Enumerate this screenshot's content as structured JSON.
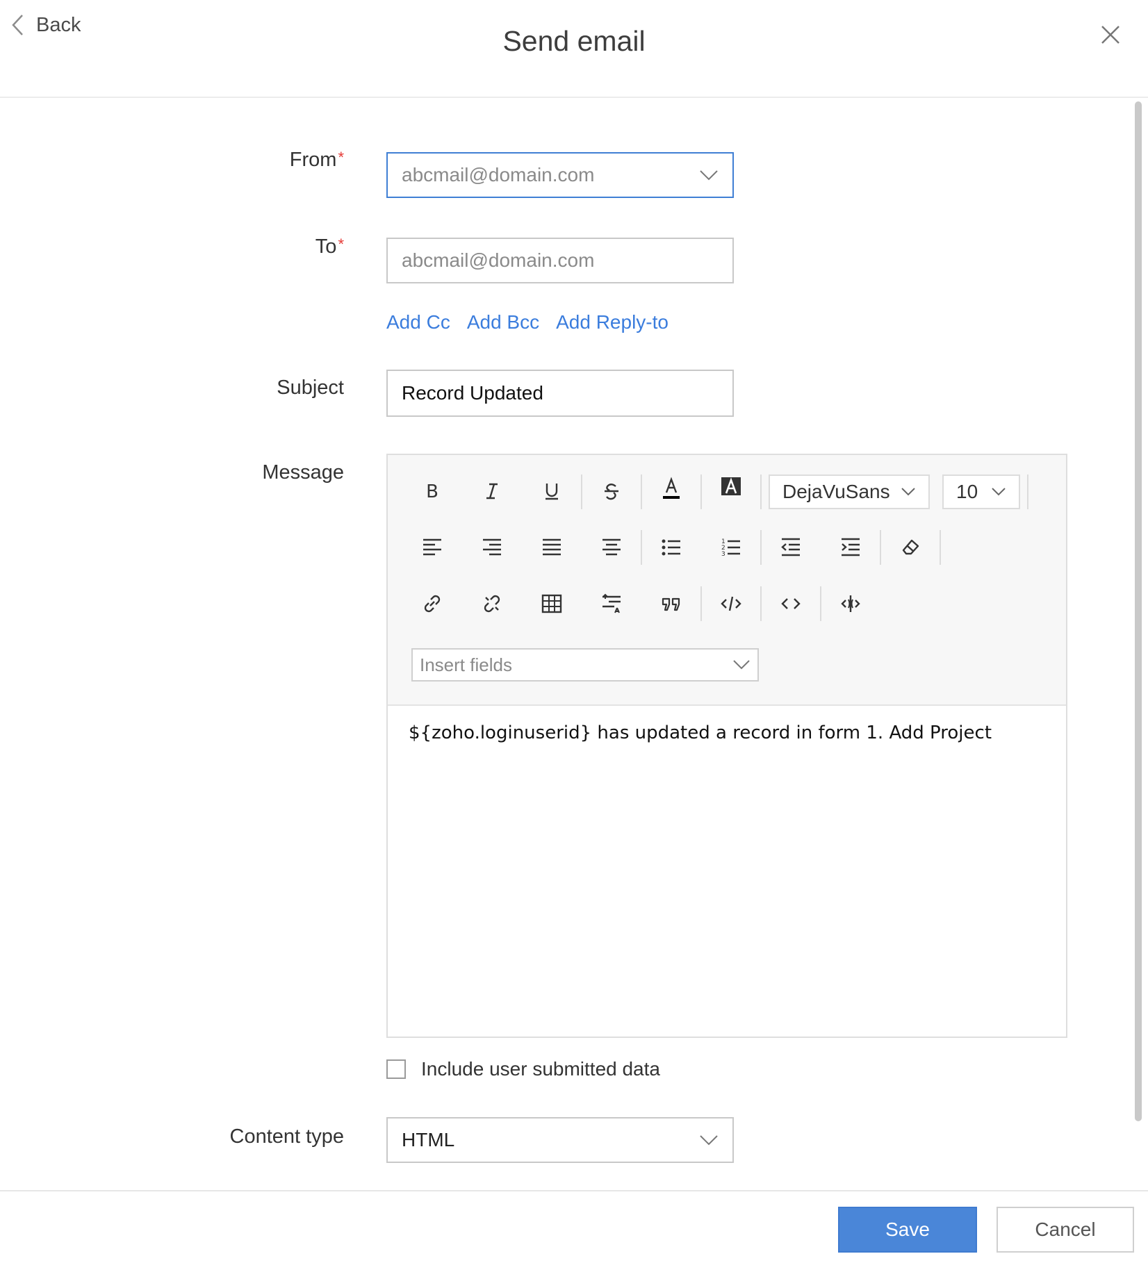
{
  "header": {
    "back_label": "Back",
    "title": "Send email"
  },
  "form": {
    "from": {
      "label": "From",
      "required_mark": "*",
      "value": "abcmail@domain.com"
    },
    "to": {
      "label": "To",
      "required_mark": "*",
      "placeholder": "abcmail@domain.com"
    },
    "recipient_links": {
      "add_cc": "Add Cc",
      "add_bcc": "Add Bcc",
      "add_reply_to": "Add Reply-to"
    },
    "subject": {
      "label": "Subject",
      "value": "Record Updated"
    },
    "message": {
      "label": "Message",
      "toolbar": {
        "row1": [
          "bold-icon",
          "italic-icon",
          "underline-icon",
          "strikethrough-icon",
          "font-color-icon",
          "highlight-color-icon"
        ],
        "font_family": "DejaVuSans",
        "font_size": "10",
        "row2": [
          "align-left-icon",
          "align-right-icon",
          "align-justify-icon",
          "align-center-icon",
          "bullet-list-icon",
          "numbered-list-icon",
          "outdent-icon",
          "indent-icon",
          "clear-format-icon"
        ],
        "row3": [
          "link-icon",
          "unlink-icon",
          "table-icon",
          "line-height-icon",
          "blockquote-icon",
          "code-block-icon",
          "html-source-icon",
          "embed-icon"
        ],
        "insert_fields_placeholder": "Insert fields"
      },
      "body": "${zoho.loginuserid} has updated a record in form 1. Add Project"
    },
    "include_user_data": {
      "label": "Include user submitted data",
      "checked": false
    },
    "content_type": {
      "label": "Content type",
      "value": "HTML"
    }
  },
  "footer": {
    "save_label": "Save",
    "cancel_label": "Cancel"
  },
  "colors": {
    "accent": "#3b7ddd",
    "save_button": "#4a86d8",
    "required": "#e53935"
  }
}
